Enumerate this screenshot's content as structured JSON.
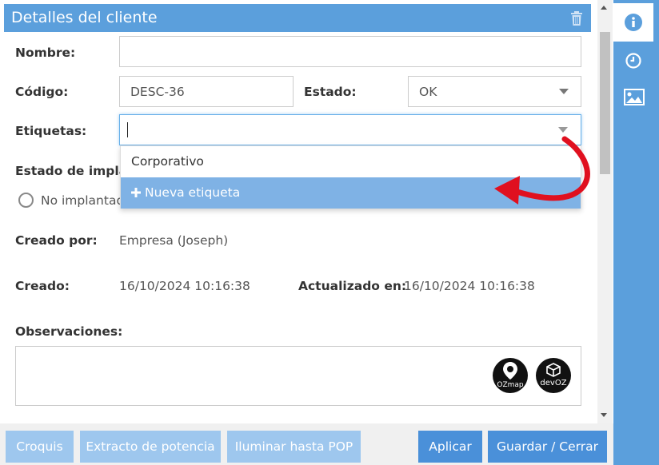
{
  "window": {
    "title": "Detalles del cliente"
  },
  "form": {
    "nombre_label": "Nombre:",
    "nombre_value": "",
    "codigo_label": "Código:",
    "codigo_value": "DESC-36",
    "estado_label": "Estado:",
    "estado_value": "OK",
    "etiquetas_label": "Etiquetas:",
    "etiquetas_value": "",
    "estado_implantacion_label": "Estado de implan",
    "radio_no_implantado": "No implantad",
    "creado_por_label": "Creado por:",
    "creado_por_value": "Empresa (Joseph)",
    "creado_label": "Creado:",
    "creado_value": "16/10/2024 10:16:38",
    "actualizado_label": "Actualizado en:",
    "actualizado_value": "16/10/2024 10:16:38",
    "observaciones_label": "Observaciones:",
    "observaciones_value": ""
  },
  "dropdown": {
    "items": [
      {
        "label": "Corporativo",
        "highlighted": false
      },
      {
        "label": "Nueva etiqueta",
        "icon": "plus-icon",
        "highlighted": true
      }
    ]
  },
  "badges": [
    {
      "name": "ozmap-logo",
      "text": "OZmap"
    },
    {
      "name": "devoz-logo",
      "text": "devOZ"
    }
  ],
  "side_tabs": [
    {
      "icon": "info-icon",
      "active": true
    },
    {
      "icon": "clock-icon",
      "active": false
    },
    {
      "icon": "image-icon",
      "active": false
    }
  ],
  "footer": {
    "croquis": "Croquis",
    "extracto": "Extracto de potencia",
    "iluminar": "Iluminar hasta POP",
    "aplicar": "Aplicar",
    "guardar": "Guardar / Cerrar"
  },
  "colors": {
    "accent": "#5b9fdc",
    "highlight": "#7fb2e5",
    "button_primary": "#4a90d9",
    "button_disabled": "#9ec7ee",
    "annotation_arrow": "#e0101f"
  }
}
